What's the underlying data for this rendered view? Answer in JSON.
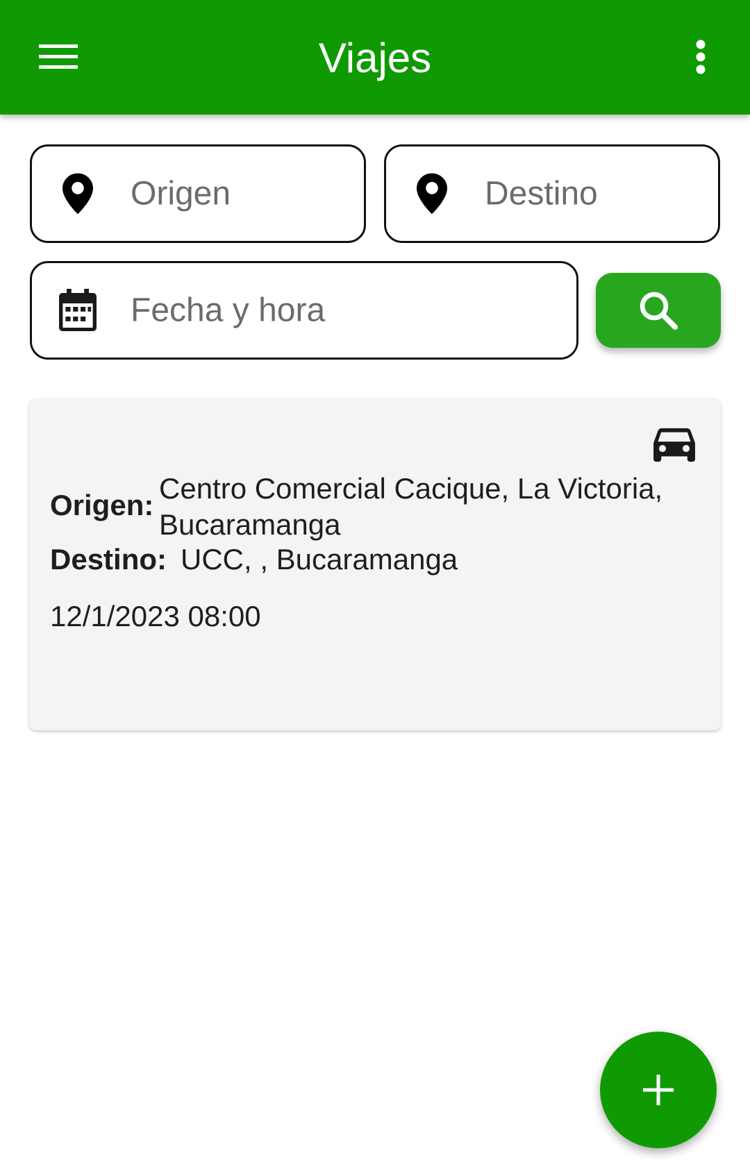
{
  "appbar": {
    "title": "Viajes",
    "menu_icon": "hamburger-menu-icon",
    "overflow_icon": "more-vert-icon",
    "color": "#0f9a03"
  },
  "search": {
    "origen_placeholder": "Origen",
    "destino_placeholder": "Destino",
    "fecha_placeholder": "Fecha y hora",
    "location_icon": "location-pin-icon",
    "calendar_icon": "calendar-icon",
    "search_icon": "search-icon",
    "button_color": "#28a71e"
  },
  "trips": [
    {
      "vehicle_icon": "car-icon",
      "origen_label": "Origen:",
      "origen_value": "Centro Comercial Cacique, La Victoria, Bucaramanga",
      "destino_label": "Destino:",
      "destino_value": "UCC, , Bucaramanga",
      "datetime": "12/1/2023 08:00"
    }
  ],
  "fab": {
    "icon": "plus-icon",
    "color": "#0f9a03"
  }
}
